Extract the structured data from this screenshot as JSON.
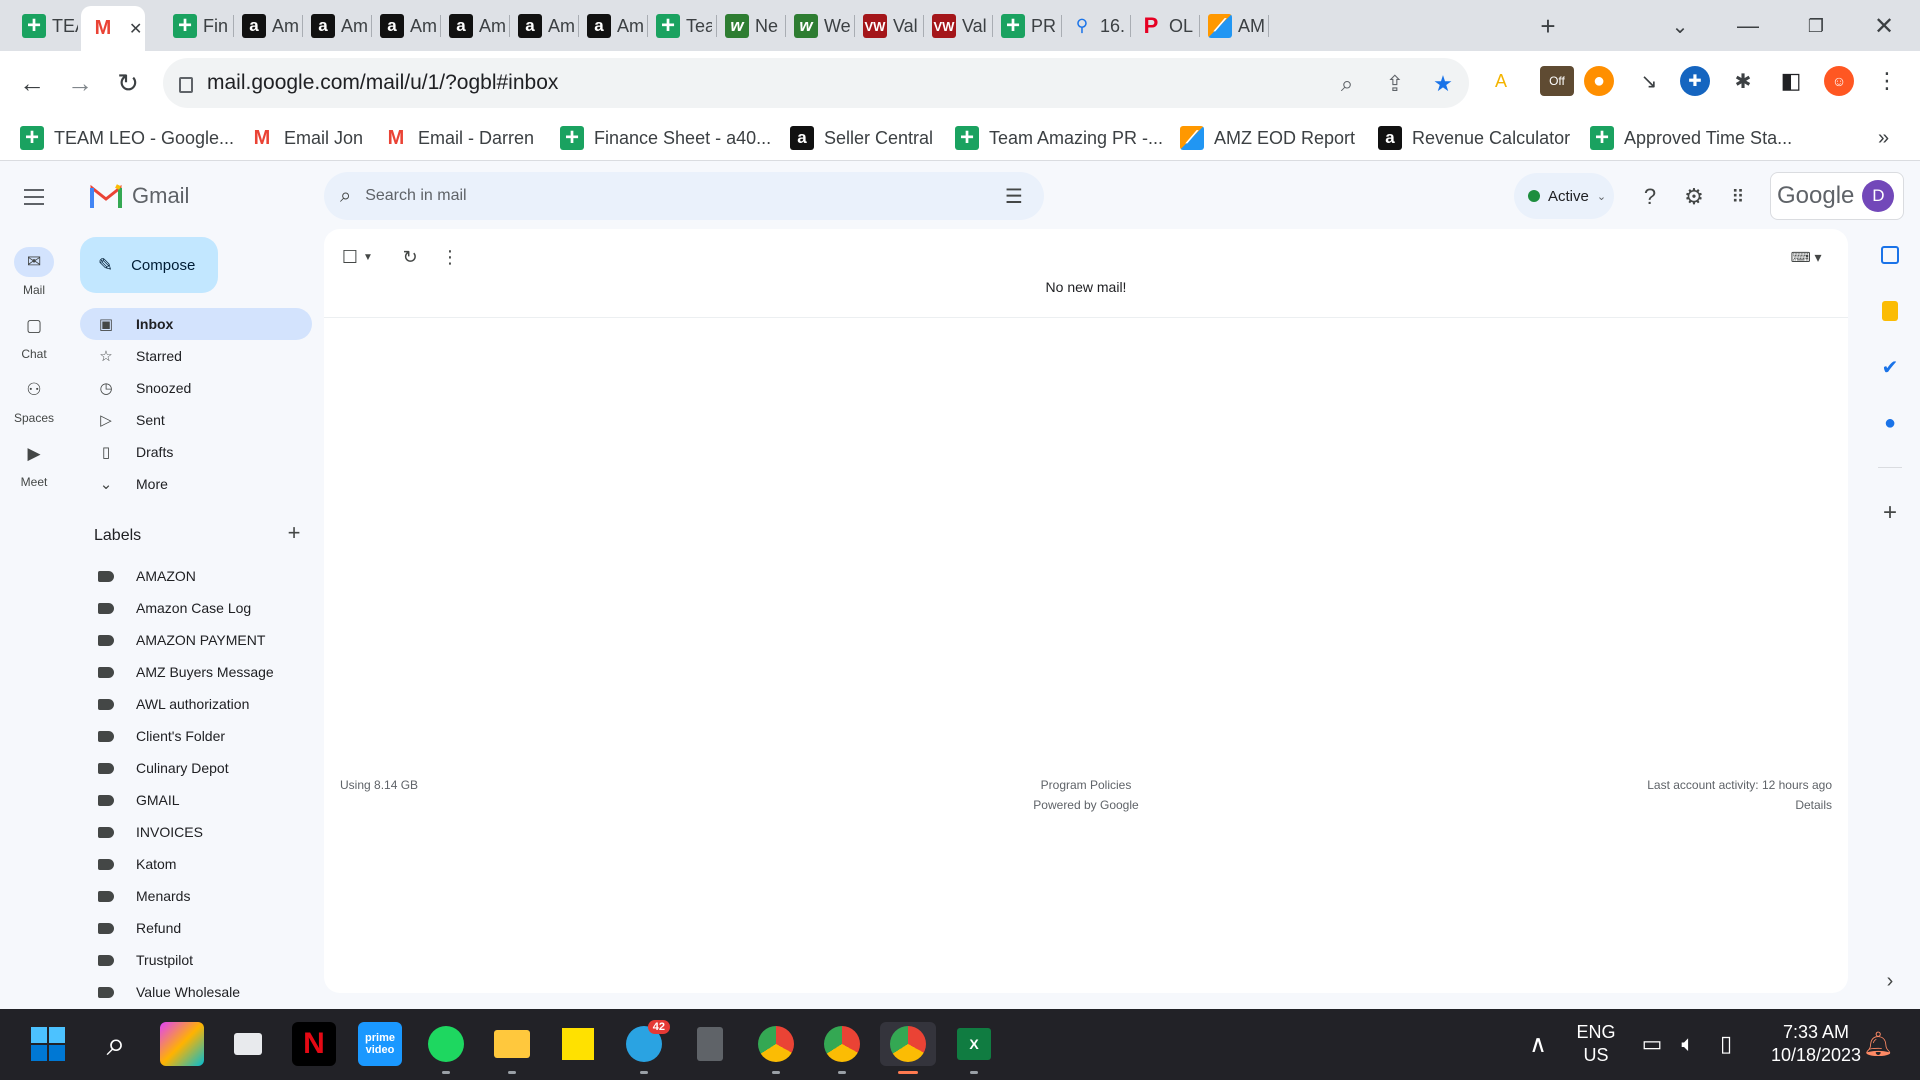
{
  "browser": {
    "tabs": [
      {
        "icon": "google-sheets-icon",
        "title": "TEA"
      },
      {
        "icon": "gmail-icon",
        "title": "",
        "active": true
      },
      {
        "icon": "google-sheets-icon",
        "title": "Fin"
      },
      {
        "icon": "amazon-icon",
        "title": "Am"
      },
      {
        "icon": "amazon-icon",
        "title": "Am"
      },
      {
        "icon": "amazon-icon",
        "title": "Am"
      },
      {
        "icon": "amazon-icon",
        "title": "Am"
      },
      {
        "icon": "amazon-icon",
        "title": "Am"
      },
      {
        "icon": "amazon-icon",
        "title": "Am"
      },
      {
        "icon": "google-sheets-icon",
        "title": "Tea"
      },
      {
        "icon": "w-icon",
        "title": "Ne"
      },
      {
        "icon": "w-icon",
        "title": "We"
      },
      {
        "icon": "vw-icon",
        "title": "Val"
      },
      {
        "icon": "vw-icon",
        "title": "Val"
      },
      {
        "icon": "google-sheets-icon",
        "title": "PR"
      },
      {
        "icon": "google-maps-icon",
        "title": "16."
      },
      {
        "icon": "pinterest-icon",
        "title": "OL"
      },
      {
        "icon": "multicolor-icon",
        "title": "AM"
      }
    ],
    "url": "mail.google.com/mail/u/1/?ogbl#inbox",
    "bookmarks": [
      {
        "icon": "google-sheets-icon",
        "label": "TEAM LEO - Google..."
      },
      {
        "icon": "gmail-icon",
        "label": "Email Jon"
      },
      {
        "icon": "gmail-icon",
        "label": "Email - Darren"
      },
      {
        "icon": "google-sheets-icon",
        "label": "Finance Sheet - a40..."
      },
      {
        "icon": "amazon-icon",
        "label": "Seller Central"
      },
      {
        "icon": "google-sheets-icon",
        "label": "Team Amazing PR -..."
      },
      {
        "icon": "multicolor-icon",
        "label": "AMZ EOD Report"
      },
      {
        "icon": "amazon-icon",
        "label": "Revenue Calculator"
      },
      {
        "icon": "google-sheets-icon",
        "label": "Approved Time Sta..."
      }
    ],
    "extension_badge": "Off"
  },
  "gmail": {
    "brand": "Gmail",
    "search_placeholder": "Search in mail",
    "status": "Active",
    "google_word": "Google",
    "avatar_initial": "D",
    "rail": [
      {
        "label": "Mail",
        "icon": "mail-icon",
        "active": true
      },
      {
        "label": "Chat",
        "icon": "chat-icon"
      },
      {
        "label": "Spaces",
        "icon": "spaces-icon"
      },
      {
        "label": "Meet",
        "icon": "meet-icon"
      }
    ],
    "compose_label": "Compose",
    "nav": [
      {
        "label": "Inbox",
        "icon": "inbox-icon",
        "active": true
      },
      {
        "label": "Starred",
        "icon": "star-icon"
      },
      {
        "label": "Snoozed",
        "icon": "clock-icon"
      },
      {
        "label": "Sent",
        "icon": "send-icon"
      },
      {
        "label": "Drafts",
        "icon": "draft-icon"
      },
      {
        "label": "More",
        "icon": "chevron-down-icon"
      }
    ],
    "labels_heading": "Labels",
    "labels": [
      "AMAZON",
      "Amazon Case Log",
      "AMAZON PAYMENT",
      "AMZ Buyers Message",
      "AWL authorization",
      "Client's Folder",
      "Culinary Depot",
      "GMAIL",
      "INVOICES",
      "Katom",
      "Menards",
      "Refund",
      "Trustpilot",
      "Value Wholesale"
    ],
    "empty_message": "No new mail!",
    "footer": {
      "storage": "Using 8.14 GB",
      "policies": "Program Policies",
      "powered": "Powered by Google",
      "activity": "Last account activity: 12 hours ago",
      "details": "Details"
    }
  },
  "taskbar": {
    "telegram_badge": "42",
    "language": "ENG",
    "region": "US",
    "time": "7:33 AM",
    "date": "10/18/2023"
  },
  "colors": {
    "accent": "#0b57d0",
    "compose_bg": "#c2e7ff",
    "active_nav": "#d3e3fd",
    "status_green": "#1e8e3e"
  }
}
